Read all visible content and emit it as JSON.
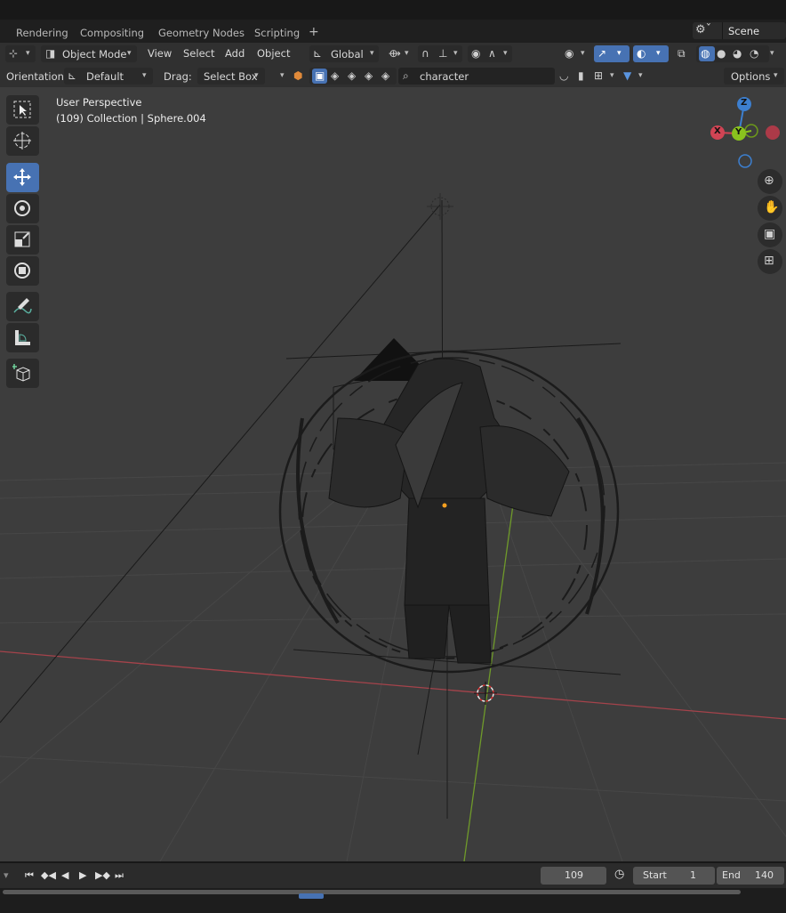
{
  "workspace_tabs": [
    "Rendering",
    "Compositing",
    "Geometry Nodes",
    "Scripting"
  ],
  "scene": {
    "name": "Scene"
  },
  "header": {
    "mode": "Object Mode",
    "menus": [
      "View",
      "Select",
      "Add",
      "Object"
    ],
    "transform_space": "Global"
  },
  "tool_header": {
    "orientation_label": "Orientation:",
    "orientation_value": "Default",
    "drag_label": "Drag:",
    "drag_value": "Select Box",
    "search_value": "character",
    "options_label": "Options"
  },
  "viewport": {
    "view_name": "User Perspective",
    "context_line": "(109) Collection | Sphere.004"
  },
  "gizmo": {
    "x": "X",
    "y": "Y",
    "z": "Z"
  },
  "tools": [
    {
      "icon": "select-box-icon",
      "active": false
    },
    {
      "icon": "cursor-icon",
      "active": false
    },
    {
      "icon": "move-icon",
      "active": true
    },
    {
      "icon": "rotate-icon",
      "active": false
    },
    {
      "icon": "scale-icon",
      "active": false
    },
    {
      "icon": "transform-icon",
      "active": false
    },
    {
      "icon": "annotate-icon",
      "active": false
    },
    {
      "icon": "measure-icon",
      "active": false
    },
    {
      "icon": "add-cube-icon",
      "active": false
    }
  ],
  "timeline": {
    "current_frame": "109",
    "start_label": "Start",
    "start_value": "1",
    "end_label": "End",
    "end_value": "140"
  },
  "colors": {
    "accent": "#4772b3",
    "x_axis": "#d14454",
    "y_axis": "#8ac21e",
    "z_axis": "#3d7fcf"
  }
}
